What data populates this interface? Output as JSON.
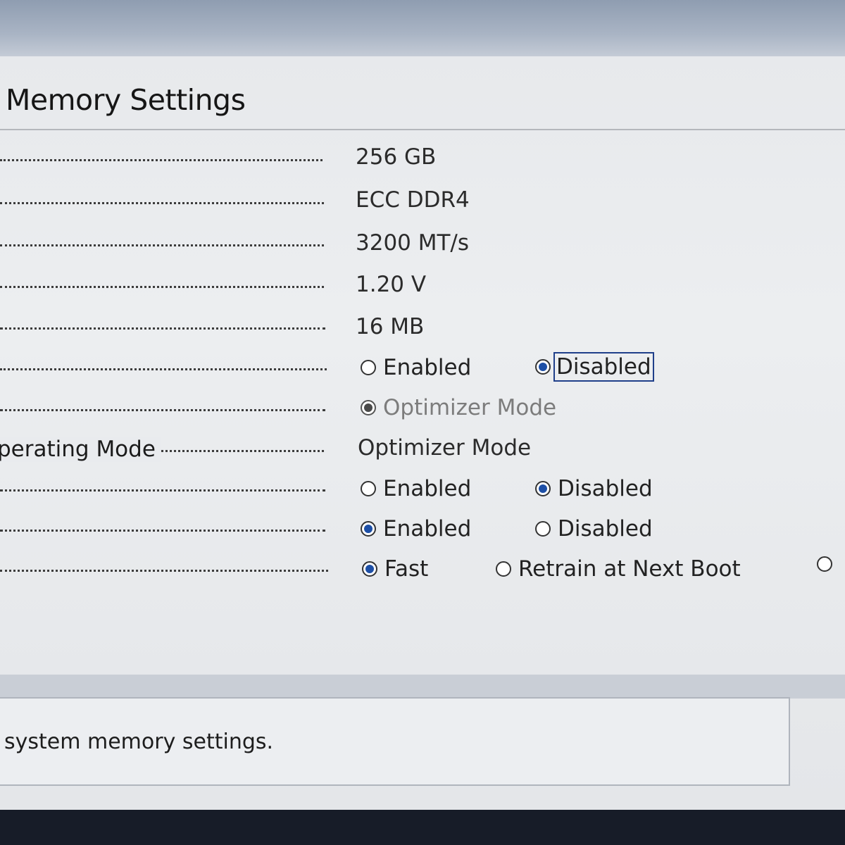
{
  "page": {
    "title": "Memory Settings",
    "help_text": "system memory settings."
  },
  "settings": {
    "row1_value": "256 GB",
    "row2_value": "ECC DDR4",
    "row3_value": "3200 MT/s",
    "row4_value": "1.20 V",
    "row5_value": "16 MB",
    "row6": {
      "option_enabled": "Enabled",
      "option_disabled": "Disabled",
      "selected": "Disabled"
    },
    "row7": {
      "option": "Optimizer Mode",
      "selected": "Optimizer Mode"
    },
    "row8": {
      "label": "perating Mode",
      "value": "Optimizer Mode"
    },
    "row9": {
      "option_enabled": "Enabled",
      "option_disabled": "Disabled",
      "selected": "Disabled"
    },
    "row10": {
      "option_enabled": "Enabled",
      "option_disabled": "Disabled",
      "selected": "Enabled"
    },
    "row11": {
      "option_fast": "Fast",
      "option_retrain": "Retrain at Next Boot",
      "selected": "Fast"
    }
  },
  "colors": {
    "radio_selected": "#1d4fa6",
    "focus_border": "#1f3f8a",
    "screen_background": "#e9ebee"
  }
}
